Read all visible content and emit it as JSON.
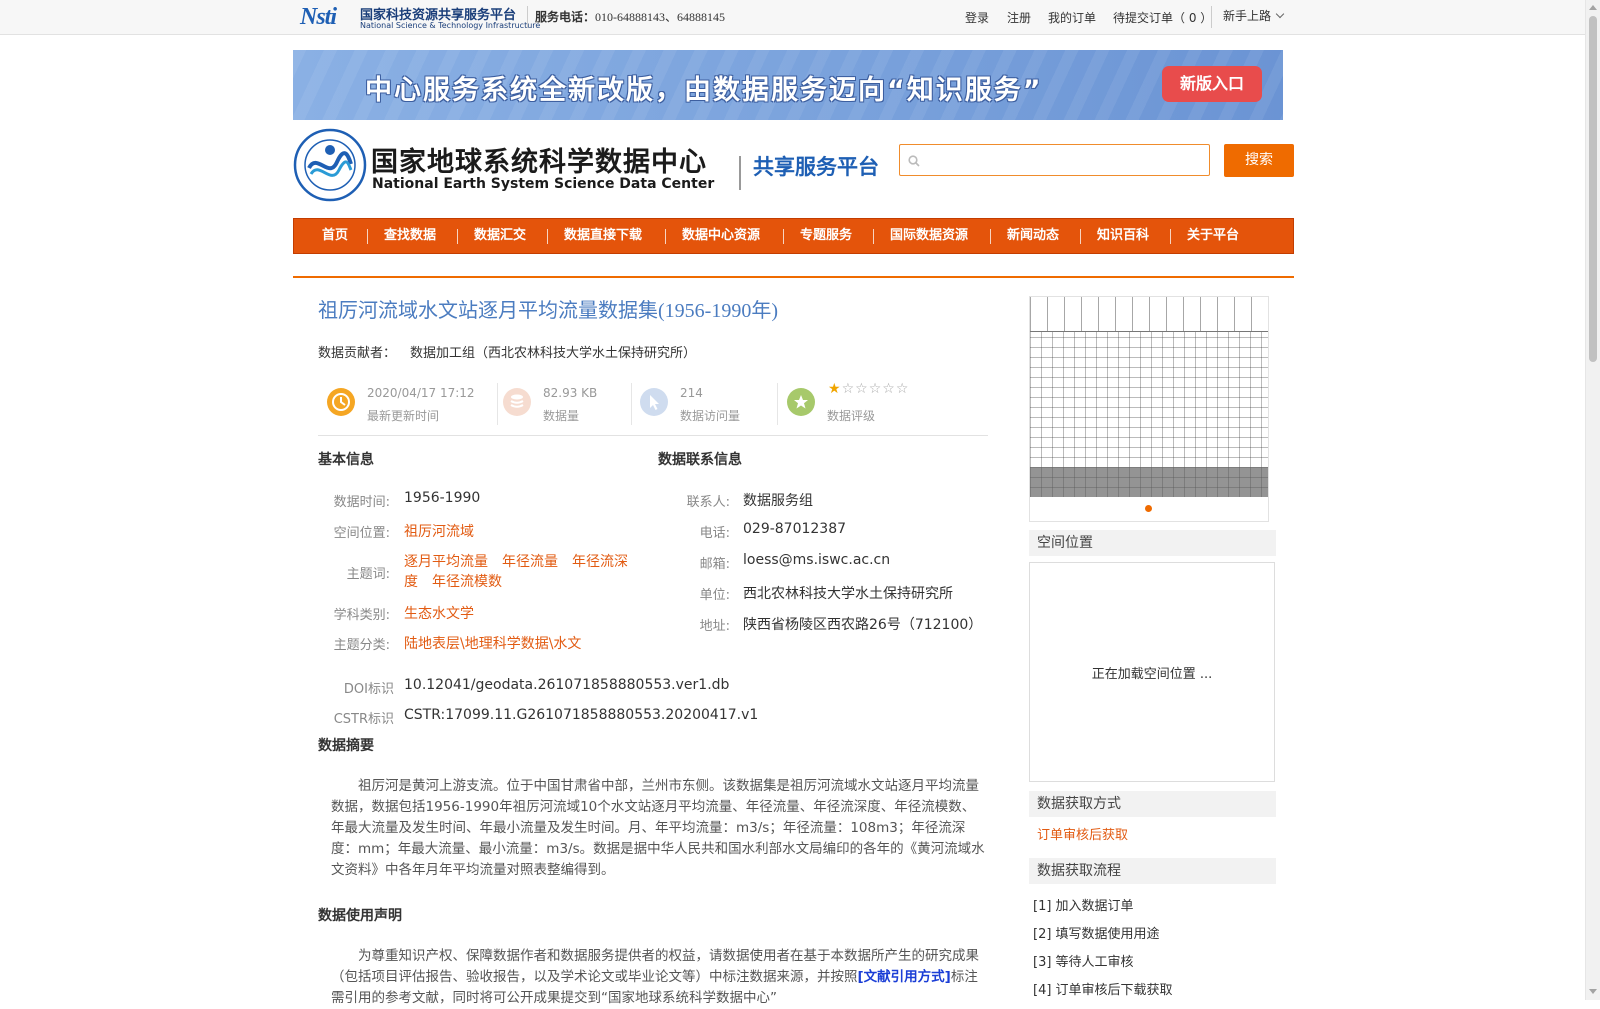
{
  "header": {
    "logo_mark": "Nsti",
    "logo_cn": "国家科技资源共享服务平台",
    "logo_en": "National Science & Technology Infrastructure",
    "phone_label": "服务电话：",
    "phone_numbers": "010-64888143、64888145",
    "links": [
      "登录",
      "注册",
      "我的订单",
      "待提交订单（ 0 ）"
    ],
    "guide": "新手上路"
  },
  "banner": {
    "text": "中心服务系统全新改版，由数据服务迈向“知识服务”",
    "button": "新版入口"
  },
  "site": {
    "name_cn": "国家地球系统科学数据中心",
    "name_en": "National Earth System Science Data Center",
    "platform": "共享服务平台"
  },
  "search": {
    "value": "",
    "button": "搜索"
  },
  "nav": [
    "首页",
    "查找数据",
    "数据汇交",
    "数据直接下载",
    "数据中心资源",
    "专题服务",
    "国际数据资源",
    "新闻动态",
    "知识百科",
    "关于平台"
  ],
  "dataset": {
    "title": "祖厉河流域水文站逐月平均流量数据集(1956-1990年)",
    "contributor_label": "数据贡献者：",
    "contributor": "数据加工组（西北农林科技大学水土保持研究所）"
  },
  "stats": {
    "updated_value": "2020/04/17 17:12",
    "updated_label": "最新更新时间",
    "size_value": "82.93 KB",
    "size_label": "数据量",
    "visits_value": "214",
    "visits_label": "数据访问量",
    "rating_label": "数据评级",
    "rating": 1,
    "rating_max": 6
  },
  "basic": {
    "heading": "基本信息",
    "time_label": "数据时间:",
    "time": "1956-1990",
    "location_label": "空间位置:",
    "location": "祖厉河流域",
    "keywords_label": "主题词:",
    "keywords": [
      "逐月平均流量",
      "年径流量",
      "年径流深度",
      "年径流模数"
    ],
    "discipline_label": "学科类别:",
    "discipline": "生态水文学",
    "category_label": "主题分类:",
    "category": "陆地表层\\地理科学数据\\水文",
    "doi_label": "DOI标识",
    "doi": "10.12041/geodata.261071858880553.ver1.db",
    "cstr_label": "CSTR标识",
    "cstr": "CSTR:17099.11.G261071858880553.20200417.v1"
  },
  "contact": {
    "heading": "数据联系信息",
    "person_label": "联系人:",
    "person": "数据服务组",
    "phone_label": "电话:",
    "phone": "029-87012387",
    "email_label": "邮箱:",
    "email": "loess@ms.iswc.ac.cn",
    "org_label": "单位:",
    "org": "西北农林科技大学水土保持研究所",
    "address_label": "地址:",
    "address": "陕西省杨陵区西农路26号（712100）"
  },
  "abstract": {
    "heading": "数据摘要",
    "text": "祖厉河是黄河上游支流。位于中国甘肃省中部，兰州市东侧。该数据集是祖厉河流域水文站逐月平均流量数据，数据包括1956-1990年祖厉河流域10个水文站逐月平均流量、年径流量、年径流深度、年径流模数、年最大流量及发生时间、年最小流量及发生时间。月、年平均流量：m3/s；年径流量：108m3；年径流深度：mm；年最大流量、最小流量：m3/s。数据是据中华人民共和国水利部水文局编印的各年的《黄河流域水文资料》中各年月年平均流量对照表整编得到。"
  },
  "usage": {
    "heading": "数据使用声明",
    "text_before": "为尊重知识产权、保障数据作者和数据服务提供者的权益，请数据使用者在基于本数据所产生的研究成果（包括项目评估报告、验收报告，以及学术论文或毕业论文等）中标注数据来源，并按照",
    "link": "[文献引用方式]",
    "text_after": "标注需引用的参考文献，同时将可公开成果提交到“国家地球系统科学数据中心”"
  },
  "sidebar": {
    "spatial_heading": "空间位置",
    "map_loading": "正在加载空间位置 ...",
    "access_heading": "数据获取方式",
    "access_method": "订单审核后获取",
    "process_heading": "数据获取流程",
    "steps": [
      "[1] 加入数据订单",
      "[2] 填写数据使用用途",
      "[3] 等待人工审核",
      "[4] 订单审核后下载获取"
    ]
  },
  "colors": {
    "accent_orange": "#ef6b00",
    "nav_bg": "#e4540b",
    "title_blue": "#4b7cc0",
    "link_orange": "#e25b12",
    "banner_blue": "#7aa2dc"
  }
}
